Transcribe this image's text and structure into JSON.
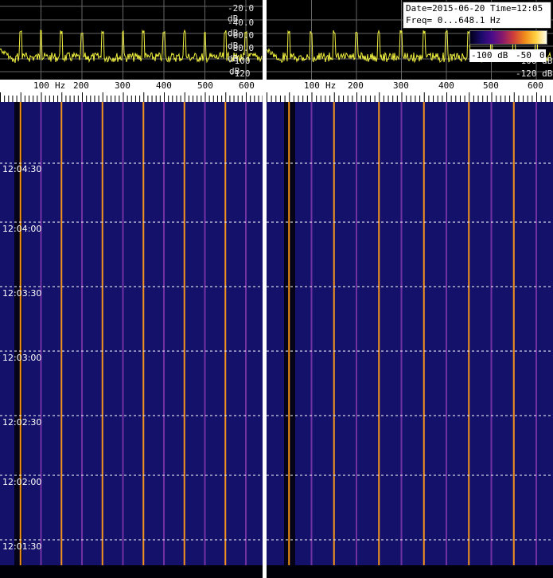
{
  "info": {
    "line1": "Date=2015-06-20 Time=12:05",
    "line2": "Freq= 0...648.1 Hz"
  },
  "colorbar": {
    "min_label": "-100 dB",
    "mid_label": "-50",
    "max_label": "0"
  },
  "left_panel": {
    "db_labels": [
      "-20.0 dB",
      "-40.0 dB",
      "-60.0 dB",
      "-80.0 dB",
      "-100 dB",
      "-120 dB"
    ],
    "freq_labels": [
      "100",
      "Hz",
      "200",
      "300",
      "400",
      "500",
      "600"
    ],
    "time_labels": [
      "12:04:30",
      "12:04:00",
      "12:03:30",
      "12:03:00",
      "12:02:30",
      "12:02:00",
      "12:01:30"
    ]
  },
  "right_panel": {
    "db_labels": [
      "-100 dB",
      "-120 dB"
    ],
    "freq_labels": [
      "100",
      "Hz",
      "200",
      "300",
      "400",
      "500",
      "600"
    ]
  },
  "colors": {
    "waterfall_bg": "#14116a",
    "trace": "#f0f040",
    "line_strong": "#ff9a1a",
    "line_weak": "#8a3ab0",
    "grid": "#ffffff"
  }
}
